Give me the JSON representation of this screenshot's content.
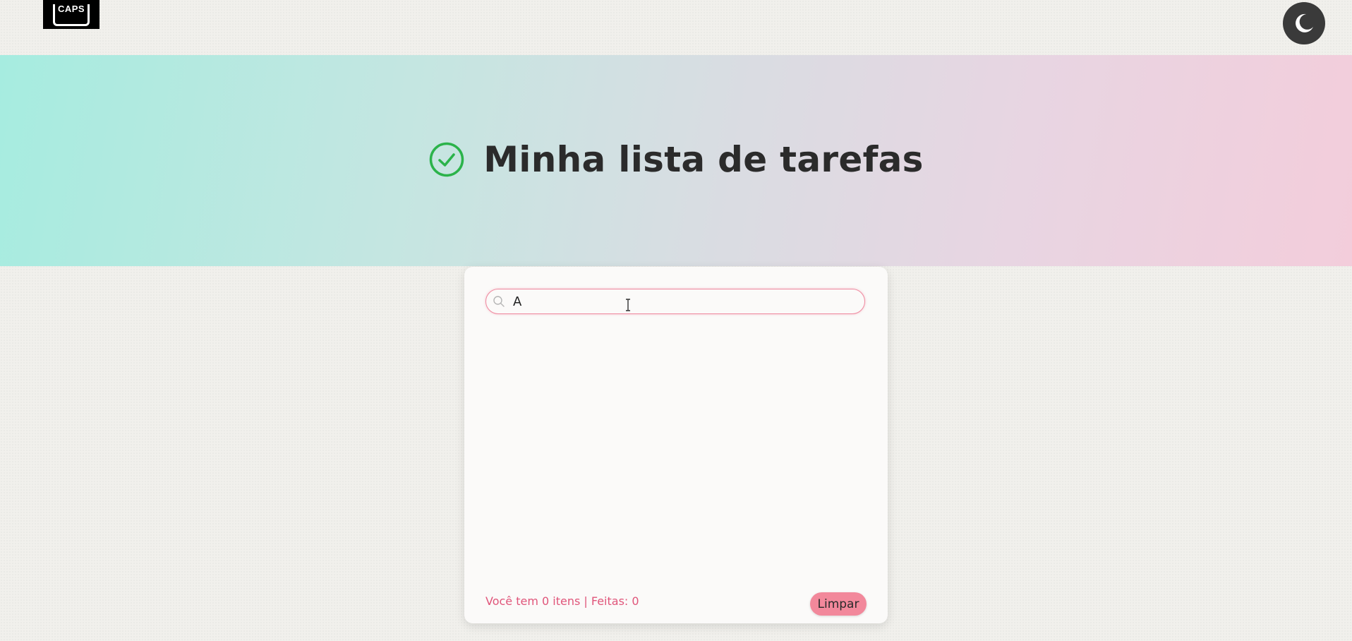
{
  "header": {
    "logo_text": "CAPS",
    "theme_toggle_icon": "moon-icon"
  },
  "hero": {
    "title": "Minha lista de tarefas",
    "icon": "check-circle-icon",
    "icon_color": "#2bb34a"
  },
  "todo": {
    "search": {
      "icon": "search-icon",
      "value": "A",
      "placeholder": ""
    },
    "status_text": "Você tem 0 itens | Feitas: 0",
    "clear_label": "Limpar"
  },
  "colors": {
    "accent_pink": "#f2889b",
    "status_text": "#e0557a",
    "hero_gradient_start": "#a6ece0",
    "hero_gradient_end": "#f3cddb"
  }
}
